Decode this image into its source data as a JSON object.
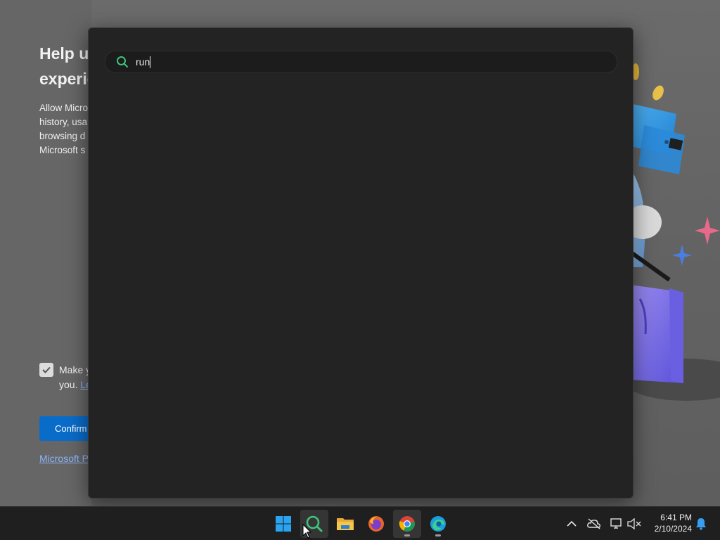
{
  "background_page": {
    "heading": "Help u\nexperie",
    "body": "Allow Micro\nhistory, usa\nbrowsing d\nMicrosoft s",
    "checkbox_text": "Make y",
    "checkbox_text_line2_prefix": "you.",
    "checkbox_link": "Le",
    "confirm_button": "Confirm",
    "privacy_link": "Microsoft P"
  },
  "search": {
    "query": "run"
  },
  "taskbar": {
    "apps": [
      {
        "name": "Start",
        "icon": "windows-logo-icon"
      },
      {
        "name": "Search (Everything)",
        "icon": "search-app-icon",
        "active": true
      },
      {
        "name": "File Explorer",
        "icon": "folder-icon"
      },
      {
        "name": "Firefox",
        "icon": "firefox-icon"
      },
      {
        "name": "Google Chrome",
        "icon": "chrome-icon",
        "running": true,
        "active": true
      },
      {
        "name": "Microsoft Edge",
        "icon": "edge-icon",
        "running": true
      }
    ],
    "clock": {
      "time": "6:41 PM",
      "date": "2/10/2024"
    }
  },
  "colors": {
    "accent": "#0a6cc9",
    "search_icon": "#3fc27a",
    "popup_bg": "#232323",
    "taskbar_bg": "#1f1f1f"
  }
}
